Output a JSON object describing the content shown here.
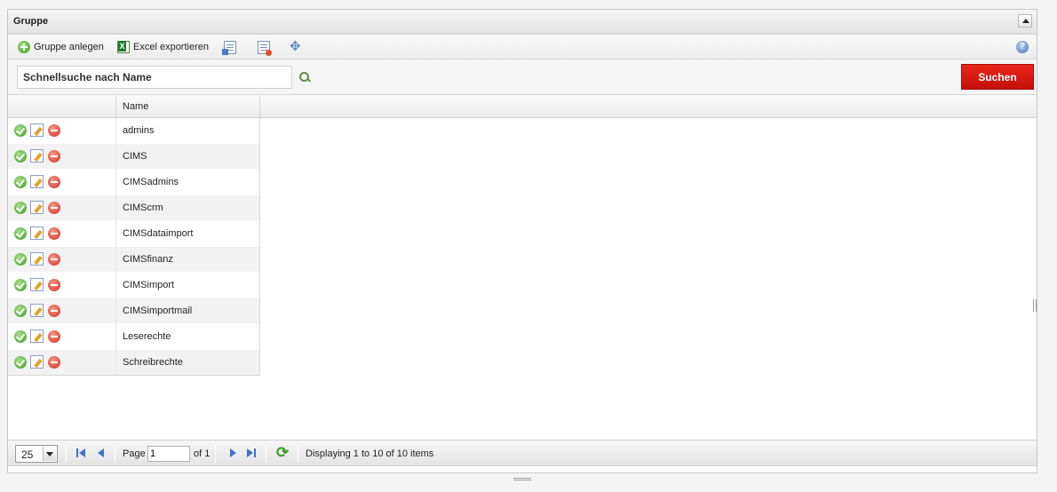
{
  "panel": {
    "title": "Gruppe"
  },
  "toolbar": {
    "add_group_label": "Gruppe anlegen",
    "excel_export_label": "Excel exportieren"
  },
  "search": {
    "placeholder": "Schnellsuche nach Name",
    "value": "",
    "submit_label": "Suchen"
  },
  "grid": {
    "columns": [
      "",
      "Name"
    ],
    "rows": [
      {
        "name": "admins"
      },
      {
        "name": "CIMS"
      },
      {
        "name": "CIMSadmins"
      },
      {
        "name": "CIMScrm"
      },
      {
        "name": "CIMSdataimport"
      },
      {
        "name": "CIMSfinanz"
      },
      {
        "name": "CIMSimport"
      },
      {
        "name": "CIMSimportmail"
      },
      {
        "name": "Leserechte"
      },
      {
        "name": "Schreibrechte"
      }
    ]
  },
  "pager": {
    "page_size": "25",
    "page_label": "Page",
    "page_value": "1",
    "of_label": "of 1",
    "status": "Displaying 1 to 10 of 10 items"
  }
}
